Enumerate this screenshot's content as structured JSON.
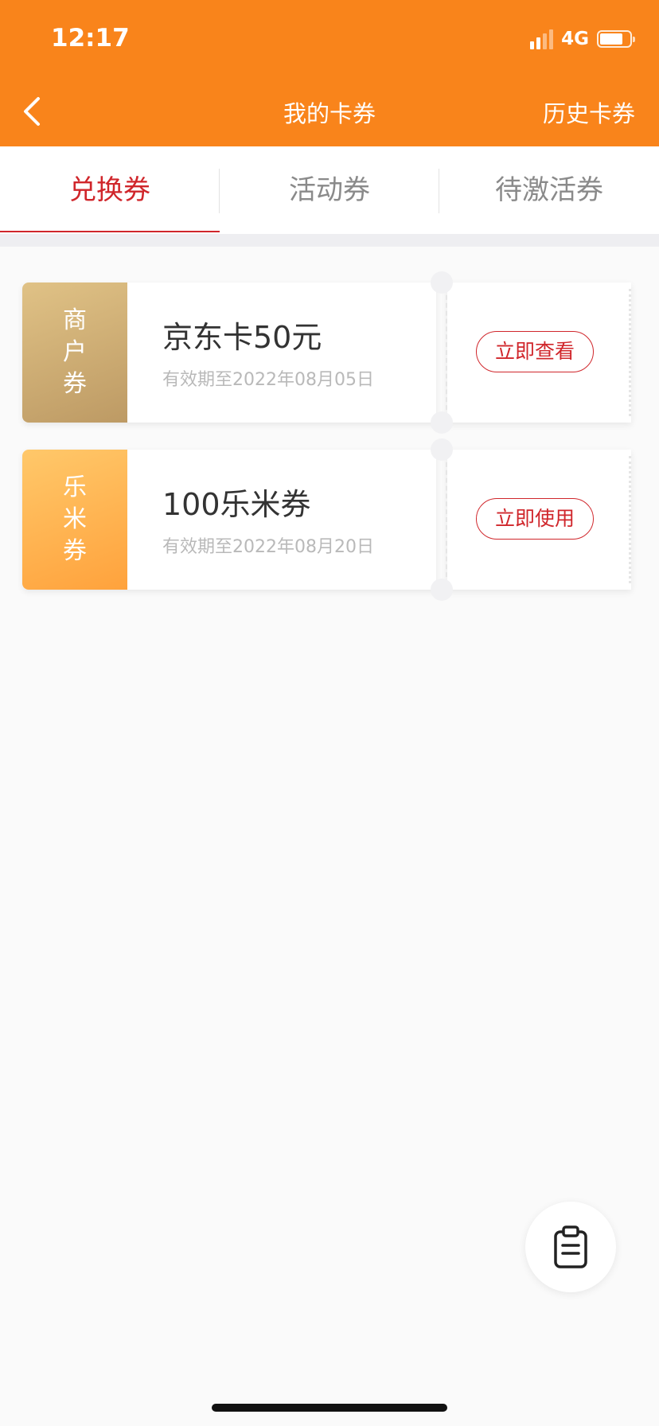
{
  "status_bar": {
    "time": "12:17",
    "network": "4G",
    "battery_percent": 70
  },
  "nav": {
    "title": "我的卡券",
    "history": "历史卡券"
  },
  "tabs": [
    {
      "label": "兑换券",
      "active": true
    },
    {
      "label": "活动券",
      "active": false
    },
    {
      "label": "待激活券",
      "active": false
    }
  ],
  "coupons": [
    {
      "tag": [
        "商",
        "户",
        "券"
      ],
      "name": "京东卡50元",
      "validity": "有效期至2022年08月05日",
      "action": "立即查看"
    },
    {
      "tag": [
        "乐",
        "米",
        "券"
      ],
      "name": "100乐米券",
      "validity": "有效期至2022年08月20日",
      "action": "立即使用"
    }
  ],
  "colors": {
    "header": "#f9841b",
    "accent": "#d0262b",
    "tag_gold": "#c9a66b",
    "tag_orange": "#ffb04a"
  },
  "icons": {
    "back": "chevron-left-icon",
    "fab": "clipboard-icon"
  }
}
